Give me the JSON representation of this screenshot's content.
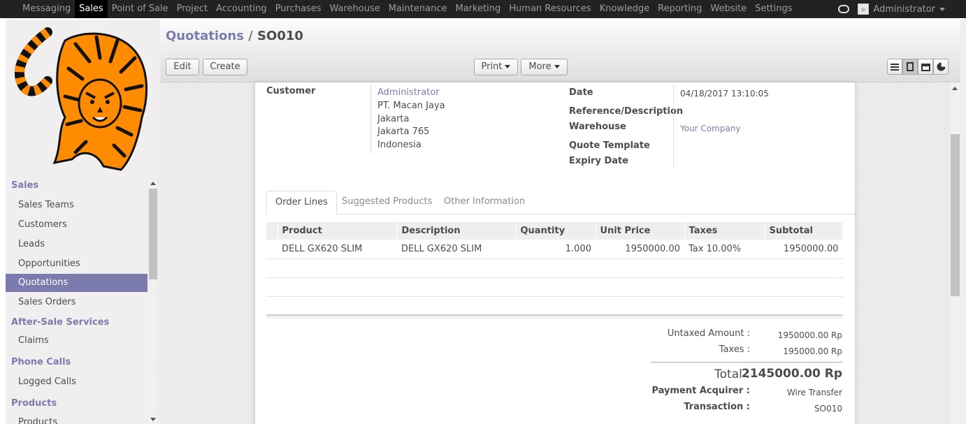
{
  "topbar": {
    "menu": [
      "Messaging",
      "Sales",
      "Point of Sale",
      "Project",
      "Accounting",
      "Purchases",
      "Warehouse",
      "Maintenance",
      "Marketing",
      "Human Resources",
      "Knowledge",
      "Reporting",
      "Website",
      "Settings"
    ],
    "active": "Sales",
    "user": "Administrator"
  },
  "sidebar": {
    "sections": [
      {
        "header": "Sales",
        "items": [
          "Sales Teams",
          "Customers",
          "Leads",
          "Opportunities",
          "Quotations",
          "Sales Orders"
        ]
      },
      {
        "header": "After-Sale Services",
        "items": [
          "Claims"
        ]
      },
      {
        "header": "Phone Calls",
        "items": [
          "Logged Calls"
        ]
      },
      {
        "header": "Products",
        "items": [
          "Products"
        ]
      }
    ],
    "active_item": "Quotations"
  },
  "breadcrumb": {
    "parent": "Quotations",
    "separator": "/",
    "current": "SO010"
  },
  "buttons": {
    "edit": "Edit",
    "create": "Create",
    "print": "Print",
    "more": "More"
  },
  "form": {
    "customer_label": "Customer",
    "customer_name": "Administrator",
    "customer_address": [
      "PT. Macan Jaya",
      "Jakarta",
      "Jakarta 765",
      "Indonesia"
    ],
    "date_label": "Date",
    "date_value": "04/18/2017 13:10:05",
    "reference_label": "Reference/Description",
    "warehouse_label": "Warehouse",
    "warehouse_value": "Your Company",
    "quote_template_label": "Quote Template",
    "expiry_label": "Expiry Date"
  },
  "tabs": [
    "Order Lines",
    "Suggested Products",
    "Other Information"
  ],
  "order_lines": {
    "columns": [
      "Product",
      "Description",
      "Quantity",
      "Unit Price",
      "Taxes",
      "Subtotal"
    ],
    "rows": [
      [
        "DELL GX620 SLIM",
        "DELL GX620 SLIM",
        "1.000",
        "1950000.00",
        "Tax 10.00%",
        "1950000.00"
      ]
    ]
  },
  "totals": {
    "untaxed_label": "Untaxed Amount :",
    "untaxed_value": "1950000.00 Rp",
    "taxes_label": "Taxes :",
    "taxes_value": "195000.00 Rp",
    "total_label": "Total :",
    "total_value": "2145000.00 Rp",
    "payment_label": "Payment Acquirer :",
    "payment_value": "Wire Transfer",
    "transaction_label": "Transaction :",
    "transaction_value": "SO010"
  },
  "colors": {
    "accent": "#7c7bad",
    "topbar": "#222222",
    "logo_orange": "#ff8c00"
  }
}
